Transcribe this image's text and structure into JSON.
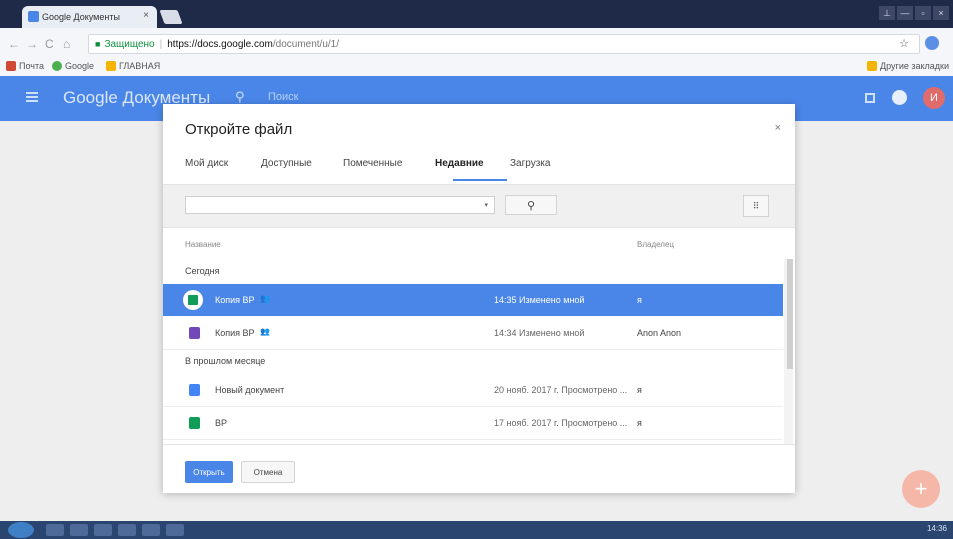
{
  "browser": {
    "tab_title": "Google Документы",
    "tab_close": "×",
    "window_buttons": [
      "⊥",
      "—",
      "▫",
      "×"
    ],
    "address": {
      "secure_label": "Защищено",
      "url_host": "https://docs.google.com",
      "url_path": "/document/u/1/"
    },
    "bookmarks": [
      {
        "label": "Почта",
        "color": "#d14836"
      },
      {
        "label": "Google",
        "color": "#4caf50"
      },
      {
        "label": "ГЛАВНАЯ",
        "color": "#f4b400"
      }
    ],
    "other_bookmarks": "Другие закладки"
  },
  "app": {
    "title": "Google Документы",
    "search_placeholder": "Поиск",
    "avatar_letter": "И",
    "accent": "#4a86e8"
  },
  "dialog": {
    "title": "Откройте файл",
    "close": "×",
    "tabs": [
      {
        "label": "Мой диск"
      },
      {
        "label": "Доступные"
      },
      {
        "label": "Помеченные"
      },
      {
        "label": "Недавние",
        "active": true
      },
      {
        "label": "Загрузка"
      }
    ],
    "search_icon": "search-icon",
    "dropdown_glyph": "▾",
    "view_toggle_glyph": "⠿",
    "columns": {
      "name": "Название",
      "owner": "Владелец"
    },
    "sections": [
      {
        "label": "Сегодня",
        "rows": [
          {
            "name": "Копия BP",
            "shared": true,
            "date": "14:35 Изменено мной",
            "owner": "я",
            "type": "sheet",
            "selected": true
          },
          {
            "name": "Копия BP",
            "shared": true,
            "date": "14:34 Изменено мной",
            "owner": "Anon Anon",
            "type": "form",
            "selected": false
          }
        ]
      },
      {
        "label": "В прошлом месяце",
        "rows": [
          {
            "name": "Новый документ",
            "shared": false,
            "date": "20 нояб. 2017 г. Просмотрено ...",
            "owner": "я",
            "type": "doc",
            "selected": false
          },
          {
            "name": "BP",
            "shared": false,
            "date": "17 нояб. 2017 г. Просмотрено ...",
            "owner": "я",
            "type": "sheet",
            "selected": false
          }
        ]
      }
    ],
    "open_button": "Открыть",
    "cancel_button": "Отмена"
  },
  "type_colors": {
    "sheet": "#0f9d58",
    "form": "#7248b9",
    "doc": "#4285f4"
  },
  "taskbar": {
    "clock": "14:36"
  }
}
